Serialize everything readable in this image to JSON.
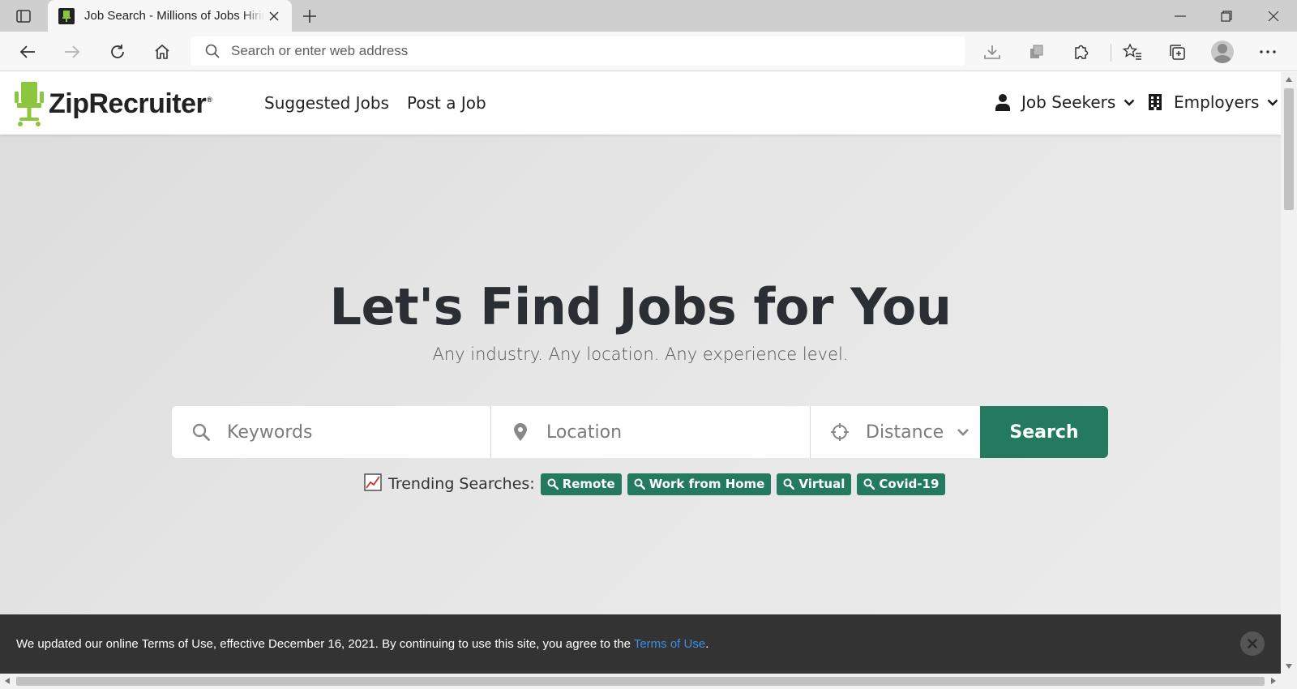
{
  "browser": {
    "tab_title": "Job Search - Millions of Jobs Hiring Near Me",
    "address_placeholder": "Search or enter web address"
  },
  "site": {
    "logo_text": "ZipRecruiter",
    "logo_mark": "®",
    "nav": {
      "suggested_jobs": "Suggested Jobs",
      "post_a_job": "Post a Job",
      "job_seekers": "Job Seekers",
      "employers": "Employers"
    },
    "brand_color": "#237a5e",
    "logo_color": "#8cc63f"
  },
  "hero": {
    "title": "Let's Find Jobs for You",
    "subtitle": "Any industry. Any location. Any experience level."
  },
  "search": {
    "keywords_placeholder": "Keywords",
    "location_placeholder": "Location",
    "distance_label": "Distance",
    "button_label": "Search"
  },
  "trending": {
    "label": "Trending Searches:",
    "items": [
      "Remote",
      "Work from Home",
      "Virtual",
      "Covid-19"
    ]
  },
  "cookie_banner": {
    "text_before": "We updated our online Terms of Use, effective December 16, 2021. By continuing to use this site, you agree to the ",
    "link_text": "Terms of Use",
    "text_after": "."
  }
}
